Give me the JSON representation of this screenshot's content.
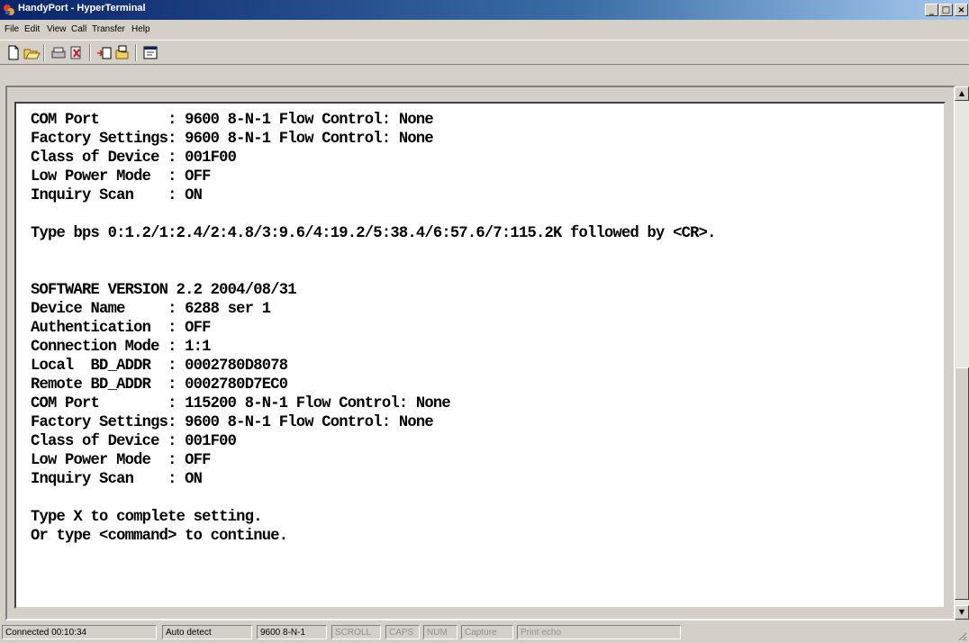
{
  "window": {
    "title": "HandyPort - HyperTerminal",
    "minimize_glyph": "_",
    "maximize_glyph": "□",
    "close_glyph": "×"
  },
  "menu": {
    "items": [
      {
        "label": "File"
      },
      {
        "label": "Edit"
      },
      {
        "label": "View"
      },
      {
        "label": "Call"
      },
      {
        "label": "Transfer"
      },
      {
        "label": "Help"
      }
    ]
  },
  "toolbar": {
    "buttons": [
      {
        "icon": "new-icon"
      },
      {
        "icon": "open-icon"
      },
      {
        "icon": "connect-icon"
      },
      {
        "icon": "disconnect-icon"
      },
      {
        "icon": "send-icon"
      },
      {
        "icon": "receive-icon"
      },
      {
        "icon": "properties-icon"
      }
    ]
  },
  "terminal": {
    "lines": [
      "COM Port        : 9600 8-N-1 Flow Control: None",
      "Factory Settings: 9600 8-N-1 Flow Control: None",
      "Class of Device : 001F00",
      "Low Power Mode  : OFF",
      "Inquiry Scan    : ON",
      "",
      "Type bps 0:1.2/1:2.4/2:4.8/3:9.6/4:19.2/5:38.4/6:57.6/7:115.2K followed by <CR>.",
      "",
      "",
      "SOFTWARE VERSION 2.2 2004/08/31",
      "Device Name     : 6288 ser 1",
      "Authentication  : OFF",
      "Connection Mode : 1:1",
      "Local  BD_ADDR  : 0002780D8078",
      "Remote BD_ADDR  : 0002780D7EC0",
      "COM Port        : 115200 8-N-1 Flow Control: None",
      "Factory Settings: 9600 8-N-1 Flow Control: None",
      "Class of Device : 001F00",
      "Low Power Mode  : OFF",
      "Inquiry Scan    : ON",
      "",
      "Type X to complete setting.",
      "Or type <command> to continue."
    ]
  },
  "scrollbar": {
    "up_glyph": "▲",
    "down_glyph": "▼"
  },
  "status": {
    "connected": "Connected 00:10:34",
    "detect": "Auto detect",
    "settings": "9600 8-N-1",
    "scroll": "SCROLL",
    "caps": "CAPS",
    "num": "NUM",
    "capture": "Capture",
    "print_echo": "Print echo"
  }
}
